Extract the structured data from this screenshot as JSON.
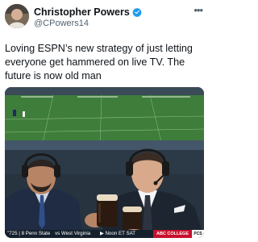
{
  "user": {
    "name": "Christopher Powers",
    "handle": "@CPowers14"
  },
  "tweet": {
    "text": "Loving ESPN’s new strategy of just letting everyone get hammered on live TV. The future is now old man"
  },
  "media": {
    "ticker": {
      "score": "\"725 | 8 Penn State",
      "vs": "vs",
      "team2": "West Virginia",
      "time": "▶ Noon ET SAT",
      "badge": "ABC COLLEGE",
      "corner": "PCS"
    }
  },
  "icons": {
    "verified": "verified-badge-icon",
    "more": "more-options-icon"
  },
  "colors": {
    "verified": "#1d9bf0",
    "secondary_text": "#536471",
    "field_green": "#3f7d3b"
  }
}
